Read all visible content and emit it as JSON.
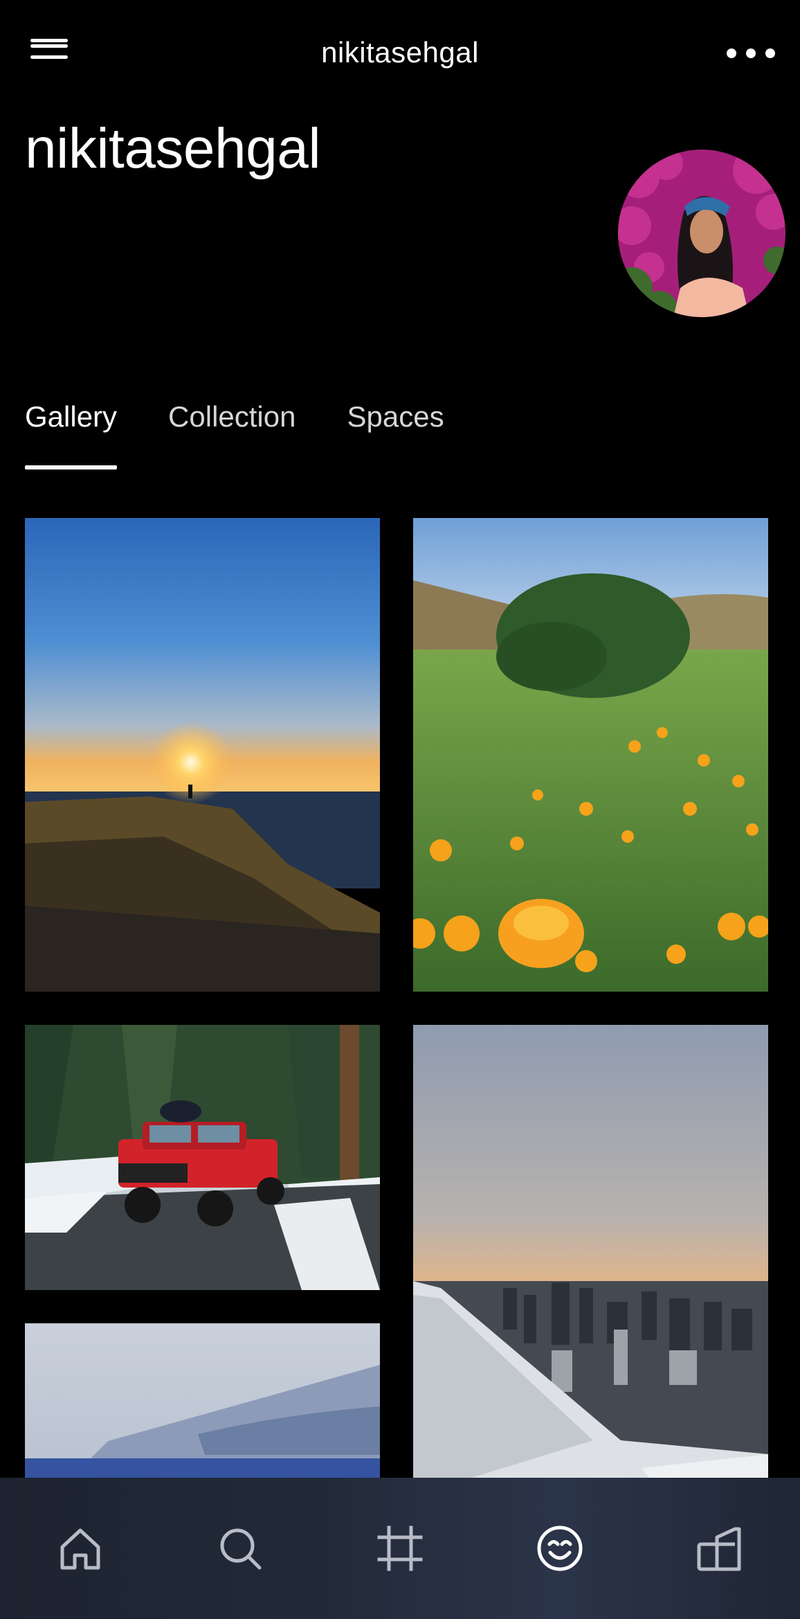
{
  "header": {
    "title": "nikitasehgal",
    "menu_icon": "hamburger-menu-icon",
    "more_icon": "more-horizontal-icon"
  },
  "profile": {
    "name": "nikitasehgal",
    "avatar_alt": "profile avatar"
  },
  "tabs": [
    {
      "label": "Gallery",
      "active": true
    },
    {
      "label": "Collection",
      "active": false
    },
    {
      "label": "Spaces",
      "active": false
    }
  ],
  "gallery": {
    "photos": [
      {
        "subject": "sunset over sea cliff with silhouette"
      },
      {
        "subject": "orange poppies in green field"
      },
      {
        "subject": "red jeep on snowy forest road"
      },
      {
        "subject": "sunset over city from airplane window"
      },
      {
        "subject": "cloudy sky over water"
      }
    ]
  },
  "bottom_nav": [
    {
      "icon": "home-icon",
      "active": false
    },
    {
      "icon": "search-icon",
      "active": false
    },
    {
      "icon": "crop-frame-icon",
      "active": false
    },
    {
      "icon": "smiley-face-icon",
      "active": true
    },
    {
      "icon": "library-icon",
      "active": false
    }
  ],
  "colors": {
    "background": "#000000",
    "text": "#ffffff",
    "inactive_tab": "#d6d6d6",
    "nav_background": "#222a39"
  }
}
